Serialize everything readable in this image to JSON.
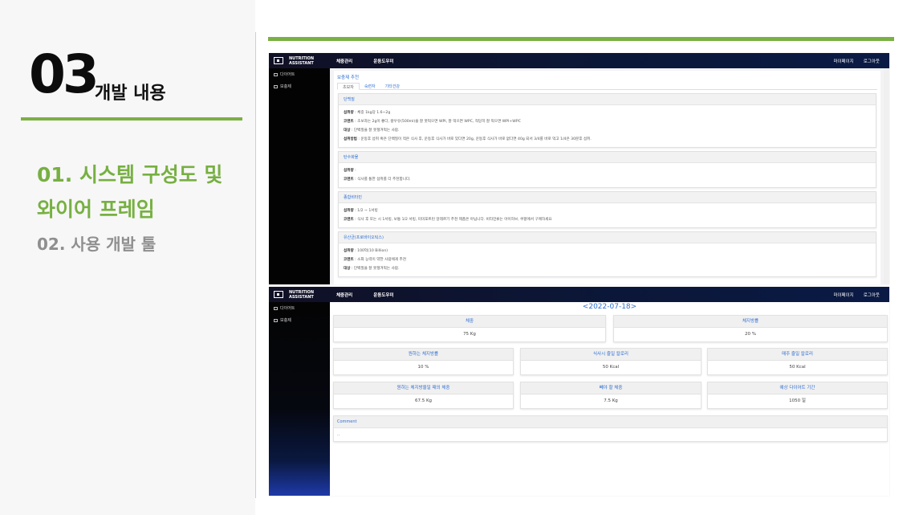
{
  "slide": {
    "section_number": "03",
    "section_title": "개발 내용",
    "subsection_1_line1": "01. 시스템 구성도 및",
    "subsection_1_line2": "와이어 프레임",
    "subsection_2": "02. 사용 개발 툴",
    "accent_color": "#7bb044"
  },
  "app": {
    "brand_line1": "NUTRITION",
    "brand_line2": "ASSISTANT",
    "nav": [
      "체중관리",
      "운동도우미"
    ],
    "nav_right": [
      "마이페이지",
      "로그아웃"
    ],
    "sidebar": [
      "다이어트",
      "보충제"
    ]
  },
  "supplement": {
    "title": "보충제 추천",
    "tabs": [
      "초보자",
      "숙련자",
      "기타건강"
    ],
    "cards": [
      {
        "title": "단백질",
        "lines": [
          {
            "label": "섭취량",
            "text": " : 체중 1kg당 1.6~2g"
          },
          {
            "label": "코멘트",
            "text": " : 초보자는 2g이 좋다, 왕우유(500ml)을 잘 못먹으면 WPI, 잘 먹으면 WPC, 적당히 잘 먹으면 WPI+WPC"
          },
          {
            "label": "대상",
            "text": " : 단백질을 잘 못챙겨먹는 사람."
          },
          {
            "label": "섭취방법",
            "text": " : 운동후 섭취 혹은 단백질이 적은 식사 후, 운동후 식사가 바로 있다면 20g, 운동후 식사가 바로 없다면 40g 되서 3/4를 바로 먹고 1/4은 30분후 섭취."
          }
        ]
      },
      {
        "title": "탄수화물",
        "lines": [
          {
            "label": "섭취량",
            "text": " : "
          },
          {
            "label": "코멘트",
            "text": " : 식사를 통한 섭취를 더 추천합니다."
          }
        ]
      },
      {
        "title": "종합비타민",
        "lines": [
          {
            "label": "섭취량",
            "text": " : 1/2 ~ 1서빙"
          },
          {
            "label": "코멘트",
            "text": " : 식사 후 또는 시 1서빙, 보통 1/2 서빙, 미미포트린 알레르기 추천 제품은 아닙니다. 비타민류는 아이허브, 쿠팡에서 구매하세요"
          }
        ]
      },
      {
        "title": "유산균(프로바이오틱스)",
        "lines": [
          {
            "label": "섭취량",
            "text": " : 100억(10 Billion)"
          },
          {
            "label": "코멘트",
            "text": " : 소화 능력이 약한 사람에게 추천"
          },
          {
            "label": "대상",
            "text": " : 단백질을 잘 못챙겨먹는 사람."
          }
        ]
      }
    ]
  },
  "diet": {
    "date": "<2022-07-18>",
    "weight_label": "체중",
    "weight_value": "75 Kg",
    "body_fat_label": "체지방률",
    "body_fat_value": "20 %",
    "target_fat_label": "원하는 체지방률",
    "target_fat_value": "10 %",
    "meal_calorie_label": "식사시 줄일 칼로리",
    "meal_calorie_value": "50 Kcal",
    "daily_calorie_label": "매주 줄일 칼로리",
    "daily_calorie_value": "50 Kcal",
    "target_weight_label": "원하는 체지방율일 때의 체중",
    "target_weight_value": "67.5 Kg",
    "lose_weight_label": "빼야 할 체중",
    "lose_weight_value": "7.5 Kg",
    "period_label": "예상 다이어트 기간",
    "period_value": "1050 일",
    "comment_label": "Comment",
    "comment_value": ".."
  }
}
